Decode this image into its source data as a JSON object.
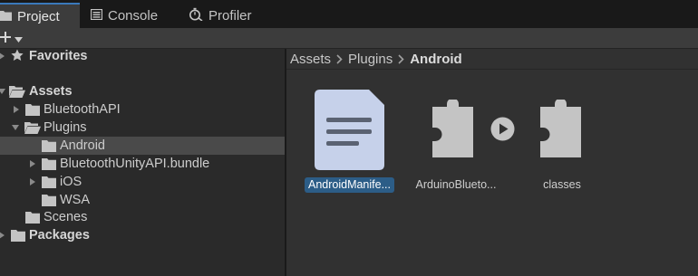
{
  "tabs": [
    {
      "label": "Project",
      "icon": "folder-icon",
      "active": true
    },
    {
      "label": "Console",
      "icon": "console-icon",
      "active": false
    },
    {
      "label": "Profiler",
      "icon": "stopwatch-icon",
      "active": false
    }
  ],
  "toolbar": {
    "add_label": "+"
  },
  "tree": {
    "favorites": "Favorites",
    "assets": "Assets",
    "bluetooth_api": "BluetoothAPI",
    "plugins": "Plugins",
    "android": "Android",
    "bundle": "BluetoothUnityAPI.bundle",
    "ios": "iOS",
    "wsa": "WSA",
    "scenes": "Scenes",
    "packages": "Packages"
  },
  "breadcrumb": [
    "Assets",
    "Plugins",
    "Android"
  ],
  "assets": [
    {
      "label": "AndroidManife...",
      "icon": "text-document-icon",
      "selected": true
    },
    {
      "label": "ArduinoBlueto...",
      "icon": "puzzle-piece-icon",
      "selected": false
    },
    {
      "label": "classes",
      "icon": "puzzle-piece-icon",
      "selected": false
    }
  ],
  "colors": {
    "selection": "#2c5d87",
    "active_tab_accent": "#3a79bb",
    "document_icon": "#c6d1ea",
    "plugin_icon": "#c4c4c4"
  }
}
